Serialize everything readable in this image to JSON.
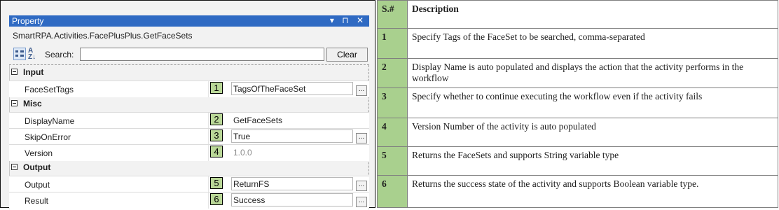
{
  "panel": {
    "title": "Property",
    "window_controls": "▾ ⊓ ✕",
    "activity_name": "SmartRPA.Activities.FacePlusPlus.GetFaceSets",
    "search": {
      "label": "Search:",
      "value": "",
      "clear_label": "Clear"
    },
    "categories": [
      {
        "name": "Input",
        "properties": [
          {
            "name": "FaceSetTags",
            "badge": "1",
            "value": "TagsOfTheFaceSet",
            "has_box": true,
            "has_ellipsis": true
          }
        ]
      },
      {
        "name": "Misc",
        "properties": [
          {
            "name": "DisplayName",
            "badge": "2",
            "value": "GetFaceSets",
            "has_box": false,
            "has_ellipsis": false
          },
          {
            "name": "SkipOnError",
            "badge": "3",
            "value": "True",
            "has_box": true,
            "has_ellipsis": true
          },
          {
            "name": "Version",
            "badge": "4",
            "value": "1.0.0",
            "has_box": false,
            "has_ellipsis": false,
            "muted": true
          }
        ]
      },
      {
        "name": "Output",
        "properties": [
          {
            "name": "Output",
            "badge": "5",
            "value": "ReturnFS",
            "has_box": true,
            "has_ellipsis": true
          },
          {
            "name": "Result",
            "badge": "6",
            "value": "Success",
            "has_box": true,
            "has_ellipsis": true
          }
        ]
      }
    ]
  },
  "description_table": {
    "headers": [
      "S.#",
      "Description"
    ],
    "rows": [
      [
        "1",
        "Specify Tags of the FaceSet to be searched, comma-separated"
      ],
      [
        "2",
        "Display Name is auto populated and displays the action that the activity performs in the workflow"
      ],
      [
        "3",
        "Specify whether to continue executing the workflow even if the activity fails"
      ],
      [
        "4",
        "Version Number of the activity is auto populated"
      ],
      [
        "5",
        "Returns the FaceSets and supports String variable type"
      ],
      [
        "6",
        "Returns the success state of the activity and supports Boolean variable type."
      ]
    ]
  },
  "colors": {
    "titlebar": "#2f6ac3",
    "badge": "#b9d797",
    "number_column": "#a9d08e"
  }
}
